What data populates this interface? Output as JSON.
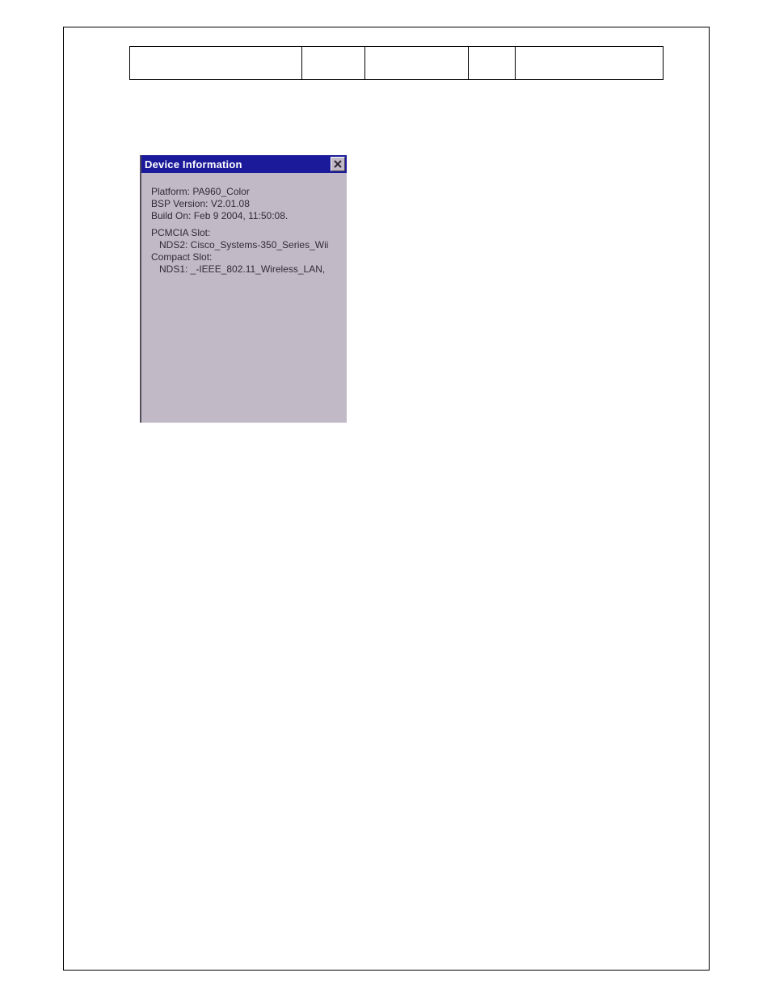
{
  "device_window": {
    "title": "Device Information",
    "lines": {
      "platform": "Platform: PA960_Color",
      "bsp_version": "BSP Version: V2.01.08",
      "build_on": "Build On: Feb  9 2004, 11:50:08.",
      "pcmcia_slot": "PCMCIA Slot:",
      "nds2": "NDS2: Cisco_Systems-350_Series_Wii",
      "compact_slot": "Compact Slot:",
      "nds1": "NDS1: _-IEEE_802.11_Wireless_LAN,"
    }
  }
}
